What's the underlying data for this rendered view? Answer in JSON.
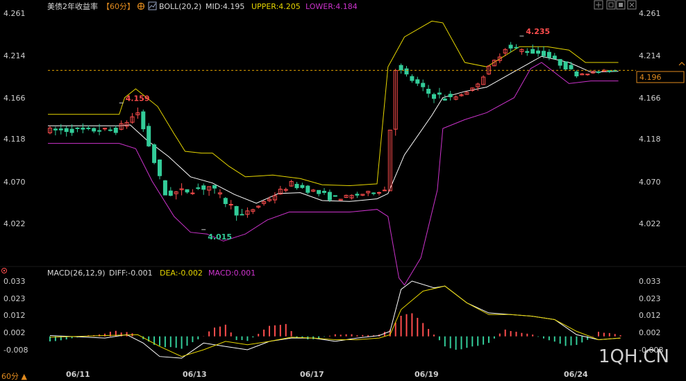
{
  "header": {
    "instrument": "美债2年收益率",
    "period_tag": "【60分】",
    "boll_label": "BOLL(20,2)",
    "mid": "MID:4.195",
    "upper": "UPPER:4.205",
    "lower": "LOWER:4.184"
  },
  "macd_header": {
    "label": "MACD(26,12,9)",
    "diff": "DIFF:-0.001",
    "dea": "DEA:-0.002",
    "macd": "MACD:0.001"
  },
  "price_axis": {
    "ticks": [
      "4.261",
      "4.214",
      "4.166",
      "4.118",
      "4.070",
      "4.022"
    ]
  },
  "macd_axis": {
    "ticks": [
      "0.033",
      "0.023",
      "0.012",
      "0.002",
      "-0.008"
    ]
  },
  "date_labels": [
    "06/11",
    "06/13",
    "06/17",
    "06/19",
    "06/24"
  ],
  "current_price": "4.196",
  "annotations": {
    "high": "4.235",
    "low": "4.015",
    "local_high": "4.159"
  },
  "period_button": "60分 ▲",
  "watermark": "1QH.CN",
  "colors": {
    "background": "#000000",
    "up": "#ff4d4d",
    "down": "#33cc99",
    "mid": "#ffffff",
    "upper": "#e6d600",
    "lower": "#cc33cc",
    "dea": "#e6d600",
    "diff": "#ffffff",
    "price_line": "#e0a000"
  },
  "chart_data": [
    {
      "type": "candlestick",
      "title": "美债2年收益率 60分",
      "indicator": "BOLL(20,2)",
      "ylim": [
        4.005,
        4.275
      ],
      "y_ticks": [
        4.261,
        4.214,
        4.166,
        4.118,
        4.07,
        4.022
      ],
      "x_labels": [
        "06/11",
        "06/13",
        "06/17",
        "06/19",
        "06/24"
      ],
      "segments": [
        {
          "from": 0,
          "to": 13,
          "start": 4.128,
          "end": 4.128,
          "vol": 0.006,
          "wig": 0.008
        },
        {
          "from": 13,
          "to": 17,
          "start": 4.128,
          "end": 4.148,
          "vol": 0.006,
          "wig": 0.007
        },
        {
          "from": 17,
          "to": 22,
          "start": 4.148,
          "end": 4.055,
          "vol": 0.007,
          "wig": 0.005
        },
        {
          "from": 22,
          "to": 30,
          "start": 4.055,
          "end": 4.064,
          "vol": 0.008,
          "wig": 0.007
        },
        {
          "from": 30,
          "to": 36,
          "start": 4.064,
          "end": 4.03,
          "vol": 0.009,
          "wig": 0.007
        },
        {
          "from": 36,
          "to": 45,
          "start": 4.03,
          "end": 4.067,
          "vol": 0.006,
          "wig": 0.004
        },
        {
          "from": 45,
          "to": 53,
          "start": 4.067,
          "end": 4.05,
          "vol": 0.007,
          "wig": 0.004
        },
        {
          "from": 53,
          "to": 62,
          "start": 4.05,
          "end": 4.06,
          "vol": 0.004,
          "wig": 0.004
        },
        {
          "from": 62,
          "to": 64,
          "start": 4.06,
          "end": 4.2,
          "vol": 0.01,
          "wig": 0.008
        },
        {
          "from": 64,
          "to": 70,
          "start": 4.2,
          "end": 4.17,
          "vol": 0.006,
          "wig": 0.005
        },
        {
          "from": 70,
          "to": 74,
          "start": 4.17,
          "end": 4.163,
          "vol": 0.01,
          "wig": 0.006
        },
        {
          "from": 74,
          "to": 78,
          "start": 4.163,
          "end": 4.175,
          "vol": 0.003,
          "wig": 0.002
        },
        {
          "from": 78,
          "to": 84,
          "start": 4.175,
          "end": 4.222,
          "vol": 0.006,
          "wig": 0.005
        },
        {
          "from": 84,
          "to": 91,
          "start": 4.222,
          "end": 4.215,
          "vol": 0.006,
          "wig": 0.006
        },
        {
          "from": 91,
          "to": 97,
          "start": 4.215,
          "end": 4.192,
          "vol": 0.005,
          "wig": 0.004
        },
        {
          "from": 97,
          "to": 104,
          "start": 4.192,
          "end": 4.196,
          "vol": 0.003,
          "wig": 0.002
        }
      ],
      "upper_pts": [
        [
          0,
          4.146
        ],
        [
          13,
          4.146
        ],
        [
          14,
          4.165
        ],
        [
          16,
          4.175
        ],
        [
          20,
          4.155
        ],
        [
          23,
          4.124
        ],
        [
          25,
          4.104
        ],
        [
          28,
          4.102
        ],
        [
          30,
          4.102
        ],
        [
          33,
          4.087
        ],
        [
          36,
          4.075
        ],
        [
          41,
          4.077
        ],
        [
          46,
          4.073
        ],
        [
          50,
          4.066
        ],
        [
          55,
          4.065
        ],
        [
          60,
          4.067
        ],
        [
          62,
          4.2
        ],
        [
          65,
          4.234
        ],
        [
          70,
          4.252
        ],
        [
          72,
          4.25
        ],
        [
          76,
          4.205
        ],
        [
          80,
          4.2
        ],
        [
          86,
          4.223
        ],
        [
          91,
          4.223
        ],
        [
          95,
          4.219
        ],
        [
          98,
          4.205
        ],
        [
          104,
          4.205
        ]
      ],
      "mid_pts": [
        [
          0,
          4.133
        ],
        [
          13,
          4.133
        ],
        [
          15,
          4.134
        ],
        [
          18,
          4.117
        ],
        [
          22,
          4.098
        ],
        [
          26,
          4.075
        ],
        [
          30,
          4.068
        ],
        [
          34,
          4.055
        ],
        [
          38,
          4.045
        ],
        [
          42,
          4.056
        ],
        [
          46,
          4.057
        ],
        [
          50,
          4.048
        ],
        [
          55,
          4.047
        ],
        [
          60,
          4.05
        ],
        [
          62,
          4.056
        ],
        [
          65,
          4.1
        ],
        [
          70,
          4.145
        ],
        [
          72,
          4.165
        ],
        [
          76,
          4.172
        ],
        [
          80,
          4.177
        ],
        [
          84,
          4.191
        ],
        [
          90,
          4.212
        ],
        [
          95,
          4.205
        ],
        [
          99,
          4.194
        ],
        [
          104,
          4.195
        ]
      ],
      "lower_pts": [
        [
          0,
          4.113
        ],
        [
          13,
          4.113
        ],
        [
          16,
          4.107
        ],
        [
          19,
          4.07
        ],
        [
          23,
          4.03
        ],
        [
          26,
          4.012
        ],
        [
          29,
          4.01
        ],
        [
          32,
          4.002
        ],
        [
          36,
          4.01
        ],
        [
          40,
          4.026
        ],
        [
          44,
          4.035
        ],
        [
          50,
          4.035
        ],
        [
          55,
          4.035
        ],
        [
          60,
          4.038
        ],
        [
          62,
          4.03
        ],
        [
          64,
          3.96
        ],
        [
          65,
          3.952
        ],
        [
          68,
          3.983
        ],
        [
          71,
          4.06
        ],
        [
          72,
          4.13
        ],
        [
          76,
          4.14
        ],
        [
          80,
          4.148
        ],
        [
          85,
          4.165
        ],
        [
          88,
          4.198
        ],
        [
          90,
          4.205
        ],
        [
          95,
          4.181
        ],
        [
          99,
          4.184
        ],
        [
          104,
          4.184
        ]
      ],
      "y_scale": [
        [
          4.261,
          19
        ],
        [
          4.214,
          80
        ],
        [
          4.166,
          141
        ],
        [
          4.118,
          200
        ],
        [
          4.07,
          262
        ],
        [
          4.022,
          322
        ]
      ],
      "last_price_value": 4.196,
      "right_axis_label": "4.196",
      "labels": [
        {
          "text": "4.159",
          "i": 13,
          "value": 4.159
        },
        {
          "text": "4.015",
          "i": 28,
          "value": 4.015
        },
        {
          "text": "4.235",
          "i": 86,
          "value": 4.235
        }
      ]
    },
    {
      "type": "bar",
      "title": "MACD(26,12,9)",
      "ylim": [
        -0.012,
        0.036
      ],
      "y_ticks": [
        0.033,
        0.023,
        0.012,
        0.002,
        -0.008
      ],
      "series": [
        {
          "name": "DIFF",
          "pts": [
            [
              0,
              0.0005
            ],
            [
              10,
              -0.001
            ],
            [
              14,
              0.001
            ],
            [
              17,
              -0.004
            ],
            [
              20,
              -0.012
            ],
            [
              24,
              -0.013
            ],
            [
              28,
              -0.004
            ],
            [
              32,
              -0.006
            ],
            [
              36,
              -0.008
            ],
            [
              40,
              -0.003
            ],
            [
              44,
              -0.001
            ],
            [
              48,
              -0.001
            ],
            [
              52,
              -0.003
            ],
            [
              56,
              -0.001
            ],
            [
              60,
              0.0005
            ],
            [
              62,
              0.003
            ],
            [
              64,
              0.028
            ],
            [
              66,
              0.033
            ],
            [
              70,
              0.029
            ],
            [
              72,
              0.03
            ],
            [
              76,
              0.02
            ],
            [
              80,
              0.014
            ],
            [
              84,
              0.013
            ],
            [
              88,
              0.012
            ],
            [
              92,
              0.01
            ],
            [
              96,
              0.001
            ],
            [
              100,
              -0.002
            ],
            [
              104,
              -0.001
            ]
          ]
        },
        {
          "name": "DEA",
          "pts": [
            [
              0,
              -0.0005
            ],
            [
              10,
              0.0005
            ],
            [
              16,
              0.001
            ],
            [
              20,
              -0.006
            ],
            [
              24,
              -0.012
            ],
            [
              28,
              -0.008
            ],
            [
              32,
              -0.003
            ],
            [
              36,
              -0.005
            ],
            [
              40,
              -0.003
            ],
            [
              44,
              -0.0005
            ],
            [
              48,
              -0.001
            ],
            [
              52,
              -0.002
            ],
            [
              56,
              -0.002
            ],
            [
              60,
              -0.001
            ],
            [
              62,
              0.001
            ],
            [
              64,
              0.016
            ],
            [
              68,
              0.027
            ],
            [
              72,
              0.03
            ],
            [
              76,
              0.02
            ],
            [
              80,
              0.013
            ],
            [
              84,
              0.013
            ],
            [
              88,
              0.012
            ],
            [
              92,
              0.01
            ],
            [
              96,
              0.003
            ],
            [
              100,
              -0.002
            ],
            [
              104,
              -0.001
            ]
          ]
        },
        {
          "name": "MACD",
          "pts": [
            [
              0,
              -0.003
            ],
            [
              8,
              0.001
            ],
            [
              12,
              0.003
            ],
            [
              15,
              0.002
            ],
            [
              17,
              -0.002
            ],
            [
              20,
              -0.006
            ],
            [
              24,
              -0.007
            ],
            [
              27,
              -0.002
            ],
            [
              30,
              0.005
            ],
            [
              32,
              0.007
            ],
            [
              34,
              -0.002
            ],
            [
              36,
              -0.003
            ],
            [
              40,
              0.006
            ],
            [
              43,
              0.007
            ],
            [
              45,
              -0.001
            ],
            [
              48,
              -0.002
            ],
            [
              52,
              0.001
            ],
            [
              56,
              0.001
            ],
            [
              60,
              0.001
            ],
            [
              62,
              0.004
            ],
            [
              64,
              0.012
            ],
            [
              66,
              0.014
            ],
            [
              68,
              0.008
            ],
            [
              70,
              0.001
            ],
            [
              72,
              -0.006
            ],
            [
              74,
              -0.008
            ],
            [
              76,
              -0.007
            ],
            [
              80,
              -0.004
            ],
            [
              83,
              0.004
            ],
            [
              86,
              0.002
            ],
            [
              88,
              0.001
            ],
            [
              90,
              -0.001
            ],
            [
              92,
              -0.003
            ],
            [
              94,
              -0.006
            ],
            [
              96,
              -0.005
            ],
            [
              98,
              -0.002
            ],
            [
              100,
              0.003
            ],
            [
              102,
              0.002
            ],
            [
              104,
              0.001
            ]
          ]
        }
      ],
      "y_scale": [
        [
          0.033,
          405
        ],
        [
          0.023,
          430
        ],
        [
          0.012,
          454
        ],
        [
          0.002,
          479
        ],
        [
          -0.008,
          504
        ]
      ]
    }
  ]
}
